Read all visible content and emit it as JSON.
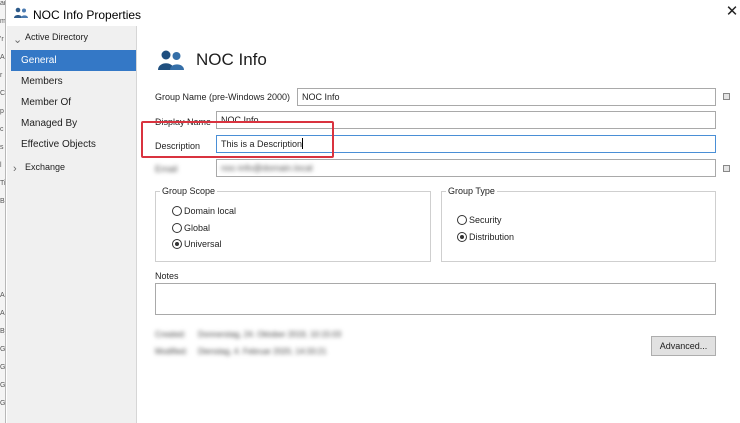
{
  "window": {
    "title": "NOC Info Properties",
    "close_glyph": "✕"
  },
  "nav": {
    "sections": [
      {
        "label": "Active Directory",
        "chevron": "⌄"
      },
      {
        "label": "Exchange",
        "chevron": "›"
      }
    ],
    "items": [
      {
        "label": "General",
        "active": true
      },
      {
        "label": "Members"
      },
      {
        "label": "Member Of"
      },
      {
        "label": "Managed By"
      },
      {
        "label": "Effective Objects"
      }
    ]
  },
  "header": {
    "title": "NOC Info",
    "icon": "group-icon"
  },
  "form": {
    "group_name_label": "Group Name (pre-Windows 2000)",
    "group_name_value": "NOC Info",
    "display_name_label": "Display Name",
    "display_name_value": "NOC Info",
    "description_label": "Description",
    "description_value": "This is a Description",
    "email_label": "Email",
    "email_value": "noc-info@domain.local"
  },
  "group_scope": {
    "title": "Group Scope",
    "options": [
      {
        "label": "Domain local",
        "checked": false
      },
      {
        "label": "Global",
        "checked": false
      },
      {
        "label": "Universal",
        "checked": true
      }
    ]
  },
  "group_type": {
    "title": "Group Type",
    "options": [
      {
        "label": "Security",
        "checked": false
      },
      {
        "label": "Distribution",
        "checked": true
      }
    ]
  },
  "notes": {
    "label": "Notes",
    "value": ""
  },
  "meta": {
    "created_label": "Created:",
    "created_value": "Donnerstag, 24. Oktober 2019, 10:15:03",
    "modified_label": "Modified:",
    "modified_value": "Dienstag, 4. Februar 2020, 14:33:21"
  },
  "buttons": {
    "advanced": "Advanced..."
  },
  "colors": {
    "accent": "#3478c6",
    "highlight": "#d9333f",
    "focus_border": "#4a8fd6"
  }
}
